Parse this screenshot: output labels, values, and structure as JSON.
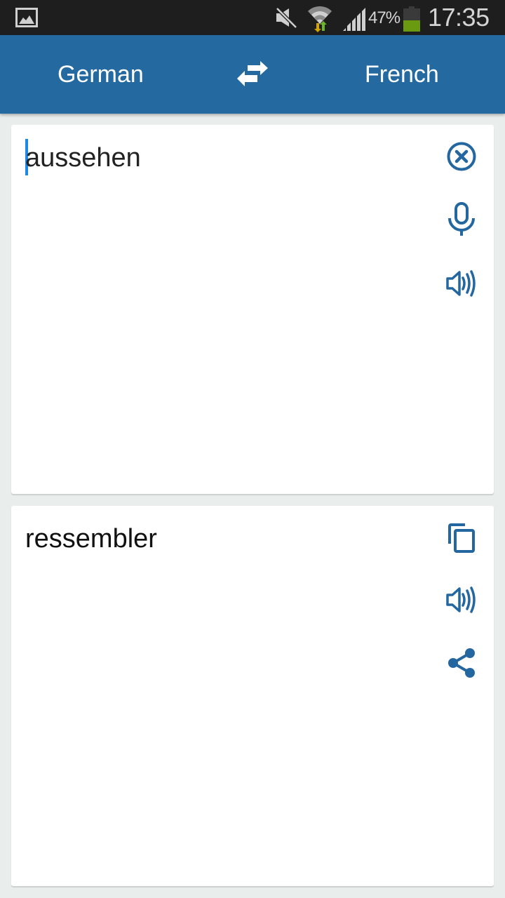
{
  "status_bar": {
    "notification_icon": "image-icon",
    "mute_icon": "mute-icon",
    "wifi_icon": "wifi-data-icon",
    "signal_icon": "signal-icon",
    "battery_percent": "47%",
    "battery_level": 0.47,
    "time": "17:35",
    "colors": {
      "background": "#1e1e1e",
      "battery_fill": "#6a9a10",
      "wifi_down": "#d1a400",
      "wifi_up": "#6ab82a"
    }
  },
  "header": {
    "source_language": "German",
    "target_language": "French",
    "swap_icon": "swap-arrows-icon",
    "color": "#246aa1"
  },
  "input_card": {
    "text": "aussehen",
    "actions": [
      {
        "name": "clear",
        "icon": "close-circle-icon"
      },
      {
        "name": "voice-input",
        "icon": "microphone-icon"
      },
      {
        "name": "speak",
        "icon": "speaker-icon"
      }
    ]
  },
  "output_card": {
    "text": "ressembler",
    "actions": [
      {
        "name": "copy",
        "icon": "copy-icon"
      },
      {
        "name": "speak",
        "icon": "speaker-icon"
      },
      {
        "name": "share",
        "icon": "share-icon"
      }
    ]
  },
  "accent_color": "#2467a0"
}
